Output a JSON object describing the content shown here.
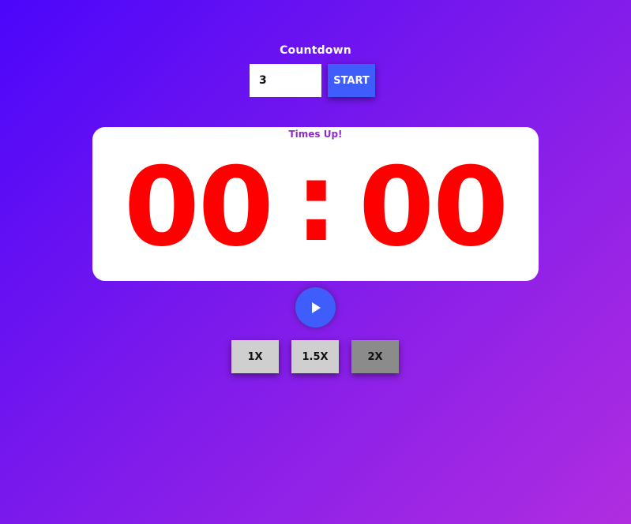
{
  "header": {
    "title": "Countdown"
  },
  "controls": {
    "minutes_value": "3",
    "start_label": "START"
  },
  "timer": {
    "status": "Times Up!",
    "minutes": "00",
    "separator": ":",
    "seconds": "00",
    "digit_color": "#ff0000"
  },
  "playback": {
    "icon": "play-icon"
  },
  "speed": {
    "options": [
      "1X",
      "1.5X",
      "2X"
    ],
    "selected": "2X"
  },
  "colors": {
    "accent": "#3f5dfb",
    "background_start": "#4b06fb",
    "background_end": "#b02de0",
    "status_text": "#8e2ad2"
  }
}
